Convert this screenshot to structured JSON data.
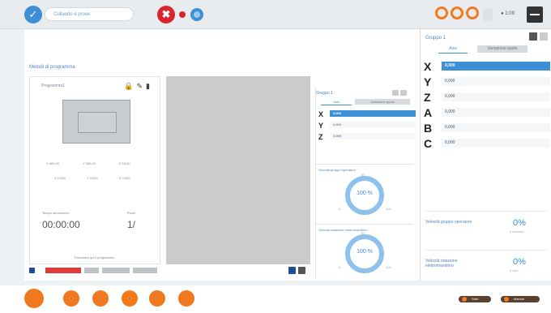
{
  "topbar": {
    "title": "Collaudo e prove",
    "status_time": "1:09"
  },
  "main": {
    "section_title": "Metodi di programma",
    "program": {
      "name": "Programma1",
      "dims": [
        "X 400,00",
        "Y 300,00",
        "Z 18,00"
      ],
      "offsets": [
        "X 0,000",
        "Y 0,000",
        "Z 0,000"
      ],
      "timer_label": "Tempo lavorazione",
      "timer": "00:00:00",
      "count_label": "Pezzi",
      "count": "1/",
      "footer": "Trascinare qui il programma"
    }
  },
  "group_panel": {
    "title": "Gruppo 1",
    "tabs": [
      "Assi",
      "Variazione quote"
    ],
    "axes": [
      {
        "label": "X",
        "value": "0,000"
      },
      {
        "label": "Y",
        "value": "0,000"
      },
      {
        "label": "Z",
        "value": "0,000"
      }
    ],
    "gauges": [
      {
        "title": "Velocità gruppo operatore",
        "value": "100 %",
        "ticks": [
          "0",
          "50",
          "100"
        ]
      },
      {
        "title": "Velocità rotazione elettromandrino",
        "value": "100 %",
        "ticks": [
          "0",
          "50",
          "100"
        ]
      }
    ]
  },
  "right_panel": {
    "title": "Gruppo 1",
    "tabs": [
      "Assi",
      "Variazione quote"
    ],
    "axes": [
      {
        "label": "X",
        "value": "0,000"
      },
      {
        "label": "Y",
        "value": "0,000"
      },
      {
        "label": "Z",
        "value": "0,000"
      },
      {
        "label": "A",
        "value": "0,000"
      },
      {
        "label": "B",
        "value": "0,000"
      },
      {
        "label": "C",
        "value": "0,000"
      }
    ],
    "speeds": [
      {
        "label": "Velocità gruppo operatore",
        "pct": "0%",
        "sub": "0 mm/min"
      },
      {
        "label": "Velocità rotazione elettromandrino",
        "pct": "0%",
        "sub": "0 rpm"
      }
    ]
  },
  "dock": {
    "btn1": "Start",
    "btn2": "Manual"
  }
}
